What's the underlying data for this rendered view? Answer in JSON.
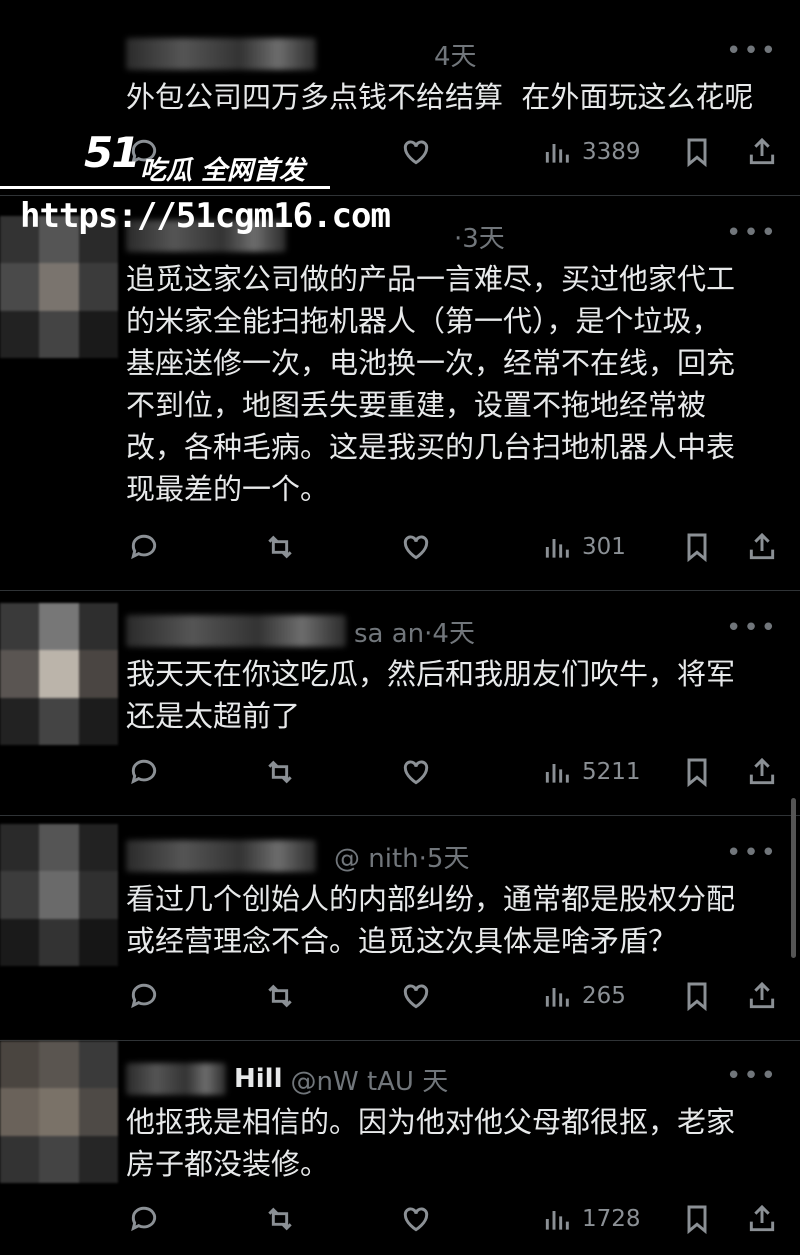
{
  "watermark": {
    "logo": "51",
    "tag": "吃瓜 全网首发",
    "url": "https://51cgm16.com"
  },
  "posts": [
    {
      "meta": "4天",
      "text": "外包公司四万多点钱不给结算  在外面玩这么花呢",
      "views": "3389"
    },
    {
      "meta": "·3天",
      "text": "追觅这家公司做的产品一言难尽，买过他家代工\n的米家全能扫拖机器人（第一代），是个垃圾，\n基座送修一次，电池换一次，经常不在线，回充\n不到位，地图丢失要重建，设置不拖地经常被\n改，各种毛病。这是我买的几台扫地机器人中表\n现最差的一个。",
      "views": "301"
    },
    {
      "meta": "sa        an·4天",
      "text": "我天天在你这吃瓜，然后和我朋友们吹牛，将军\n还是太超前了",
      "views": "5211"
    },
    {
      "meta": "@        nith·5天",
      "text": "看过几个创始人的内部纠纷，通常都是股权分配\n或经营理念不合。追觅这次具体是啥矛盾？",
      "views": "265"
    },
    {
      "name": "Hill",
      "meta": "@nW        tAU        天",
      "text": "他抠我是相信的。因为他对他父母都很抠，老家\n房子都没装修。",
      "views": "1728"
    }
  ],
  "icons": {
    "reply": "reply-icon",
    "repost": "repost-icon",
    "like": "like-icon",
    "views": "views-icon",
    "bookmark": "bookmark-icon",
    "share": "share-icon",
    "more": "more-icon"
  },
  "colors": {
    "background": "#000000",
    "text": "#e7e9ea",
    "muted": "#71767b"
  }
}
